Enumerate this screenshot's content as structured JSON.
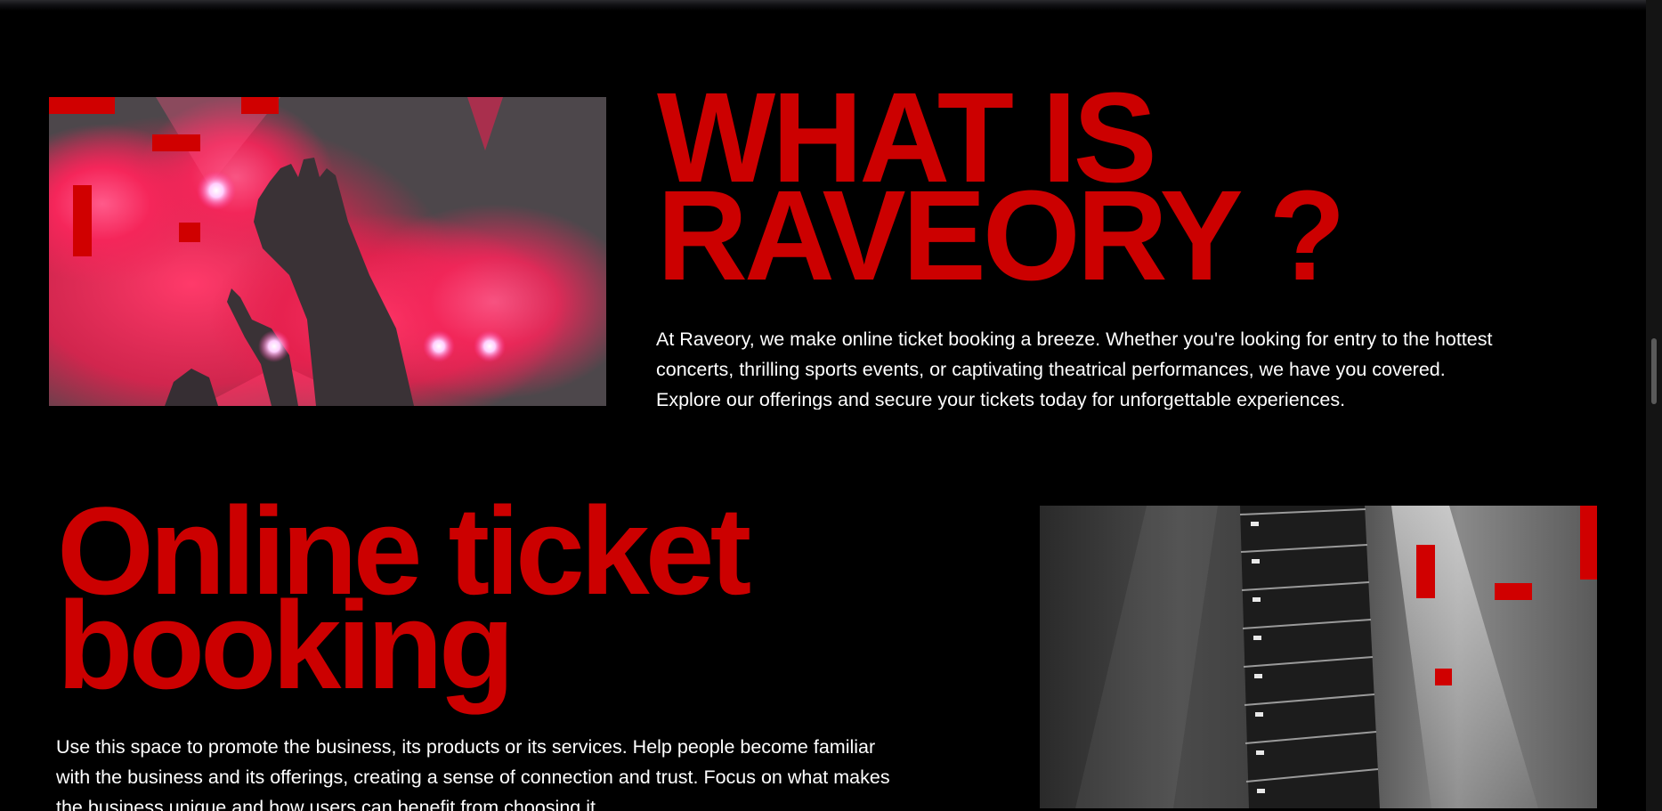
{
  "colors": {
    "background": "#000000",
    "accent": "#cc0000",
    "text": "#ffffff"
  },
  "about": {
    "title_line1": "WHAT IS",
    "title_line2": "RAVEORY ?",
    "body": "At Raveory, we make online ticket booking a breeze. Whether you're looking for entry to the hottest concerts, thrilling sports events, or captivating theatrical performances, we have you covered. Explore our offerings and secure your tickets today for unforgettable experiences."
  },
  "feature": {
    "title_line1": "Online ticket",
    "title_line2": "booking",
    "body": "Use this space to promote the business, its products or its services. Help people become familiar with the business and its offerings, creating a sense of connection and trust. Focus on what makes the business unique and how users can benefit from choosing it."
  }
}
